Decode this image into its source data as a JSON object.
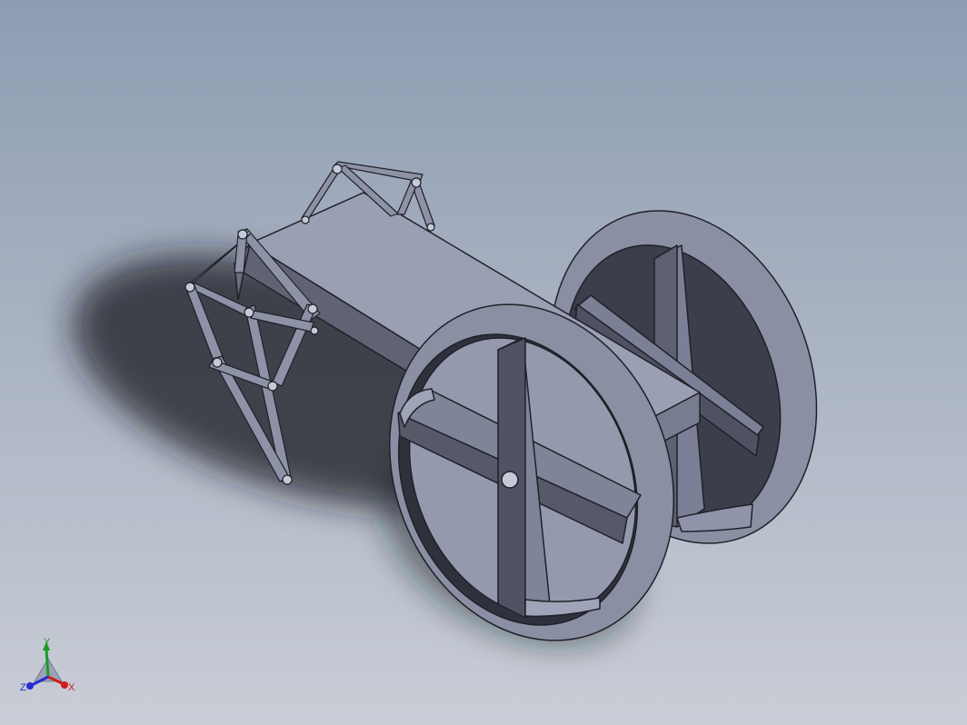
{
  "viewport": {
    "background_top": "#8e9cb2",
    "background_bottom": "#c9cdd6"
  },
  "model": {
    "body_color": "#9a9fb4",
    "wheel_color": "#8e93a8",
    "edge_color": "#1f2129",
    "dark_face": "#5a5e6e",
    "shadow_color": "#1a1c22"
  },
  "triad": {
    "x_label": "X",
    "y_label": "Y",
    "z_label": "Z",
    "x_color": "#d01e1e",
    "y_color": "#1e9a2a",
    "z_color": "#2a2ad0"
  }
}
